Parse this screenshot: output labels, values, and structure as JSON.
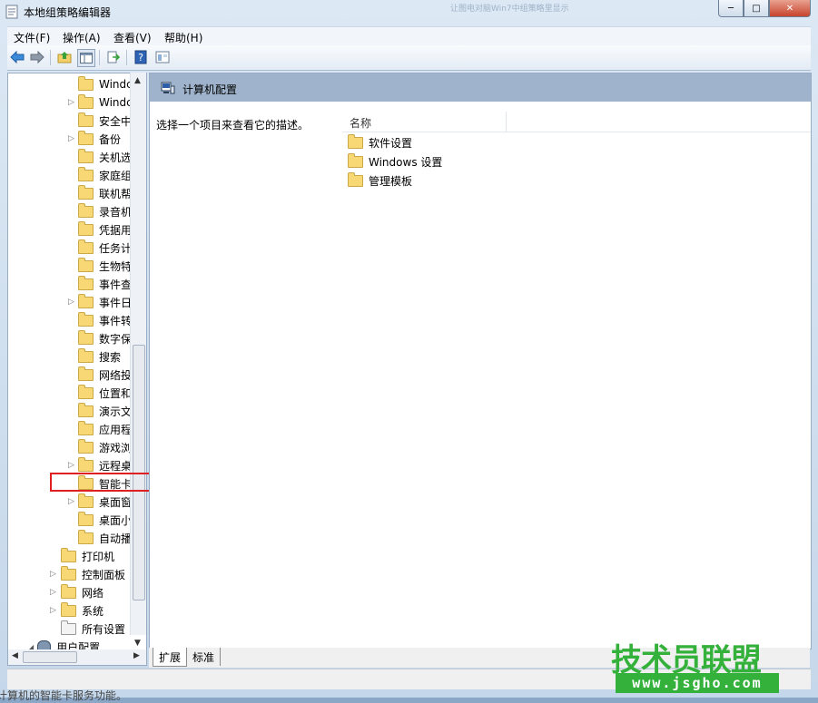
{
  "window": {
    "title": "本地组策略编辑器",
    "ghost_title": "让图电对脑Win7中组策略里显示"
  },
  "caption": {
    "minimize": "─",
    "maximize": "□",
    "close": "✕"
  },
  "menu": [
    {
      "label": "文件(F)"
    },
    {
      "label": "操作(A)"
    },
    {
      "label": "查看(V)"
    },
    {
      "label": "帮助(H)"
    }
  ],
  "toolbar": {
    "icons": [
      "back-arrow-icon",
      "forward-arrow-icon",
      "up-folder-icon",
      "show-tree-icon",
      "export-list-icon",
      "help-icon",
      "properties-icon"
    ]
  },
  "tree": {
    "items": [
      {
        "label": "Windc",
        "expander": false
      },
      {
        "label": "Windc",
        "expander": true
      },
      {
        "label": "安全中",
        "expander": false
      },
      {
        "label": "备份",
        "expander": true
      },
      {
        "label": "关机选",
        "expander": false
      },
      {
        "label": "家庭组",
        "expander": false
      },
      {
        "label": "联机帮",
        "expander": false
      },
      {
        "label": "录音机",
        "expander": false
      },
      {
        "label": "凭据用",
        "expander": false
      },
      {
        "label": "任务计",
        "expander": false
      },
      {
        "label": "生物特",
        "expander": false
      },
      {
        "label": "事件查",
        "expander": false
      },
      {
        "label": "事件日",
        "expander": true
      },
      {
        "label": "事件转",
        "expander": false
      },
      {
        "label": "数字保",
        "expander": false
      },
      {
        "label": "搜索",
        "expander": false
      },
      {
        "label": "网络投",
        "expander": false
      },
      {
        "label": "位置和",
        "expander": false
      },
      {
        "label": "演示文",
        "expander": false
      },
      {
        "label": "应用程",
        "expander": false
      },
      {
        "label": "游戏浏",
        "expander": false
      },
      {
        "label": "远程桌",
        "expander": true
      },
      {
        "label": "智能卡",
        "expander": false
      },
      {
        "label": "桌面窗",
        "expander": true
      },
      {
        "label": "桌面小",
        "expander": false
      },
      {
        "label": "自动播",
        "expander": false
      }
    ],
    "parent_items": [
      {
        "label": "打印机",
        "expander": false,
        "icon": "folder"
      },
      {
        "label": "控制面板",
        "expander": true,
        "icon": "folder"
      },
      {
        "label": "网络",
        "expander": true,
        "icon": "folder"
      },
      {
        "label": "系统",
        "expander": true,
        "icon": "folder"
      },
      {
        "label": "所有设置",
        "expander": false,
        "icon": "settings"
      }
    ],
    "root_item": {
      "label": "用户配置"
    }
  },
  "main": {
    "header_title": "计算机配置",
    "description": "选择一个项目来查看它的描述。",
    "column_name": "名称",
    "items": [
      {
        "label": "软件设置"
      },
      {
        "label": "Windows 设置"
      },
      {
        "label": "管理模板"
      }
    ]
  },
  "tabs": [
    {
      "label": "扩展"
    },
    {
      "label": "标准"
    }
  ],
  "status": {
    "text": "计算机的智能卡服务功能。"
  },
  "watermark": {
    "top": "技术员联盟",
    "bottom": "www.jsgho.com"
  },
  "colors": {
    "highlight": "#e02020",
    "watermark": "#33b13a",
    "header": "#9fb4cc"
  }
}
